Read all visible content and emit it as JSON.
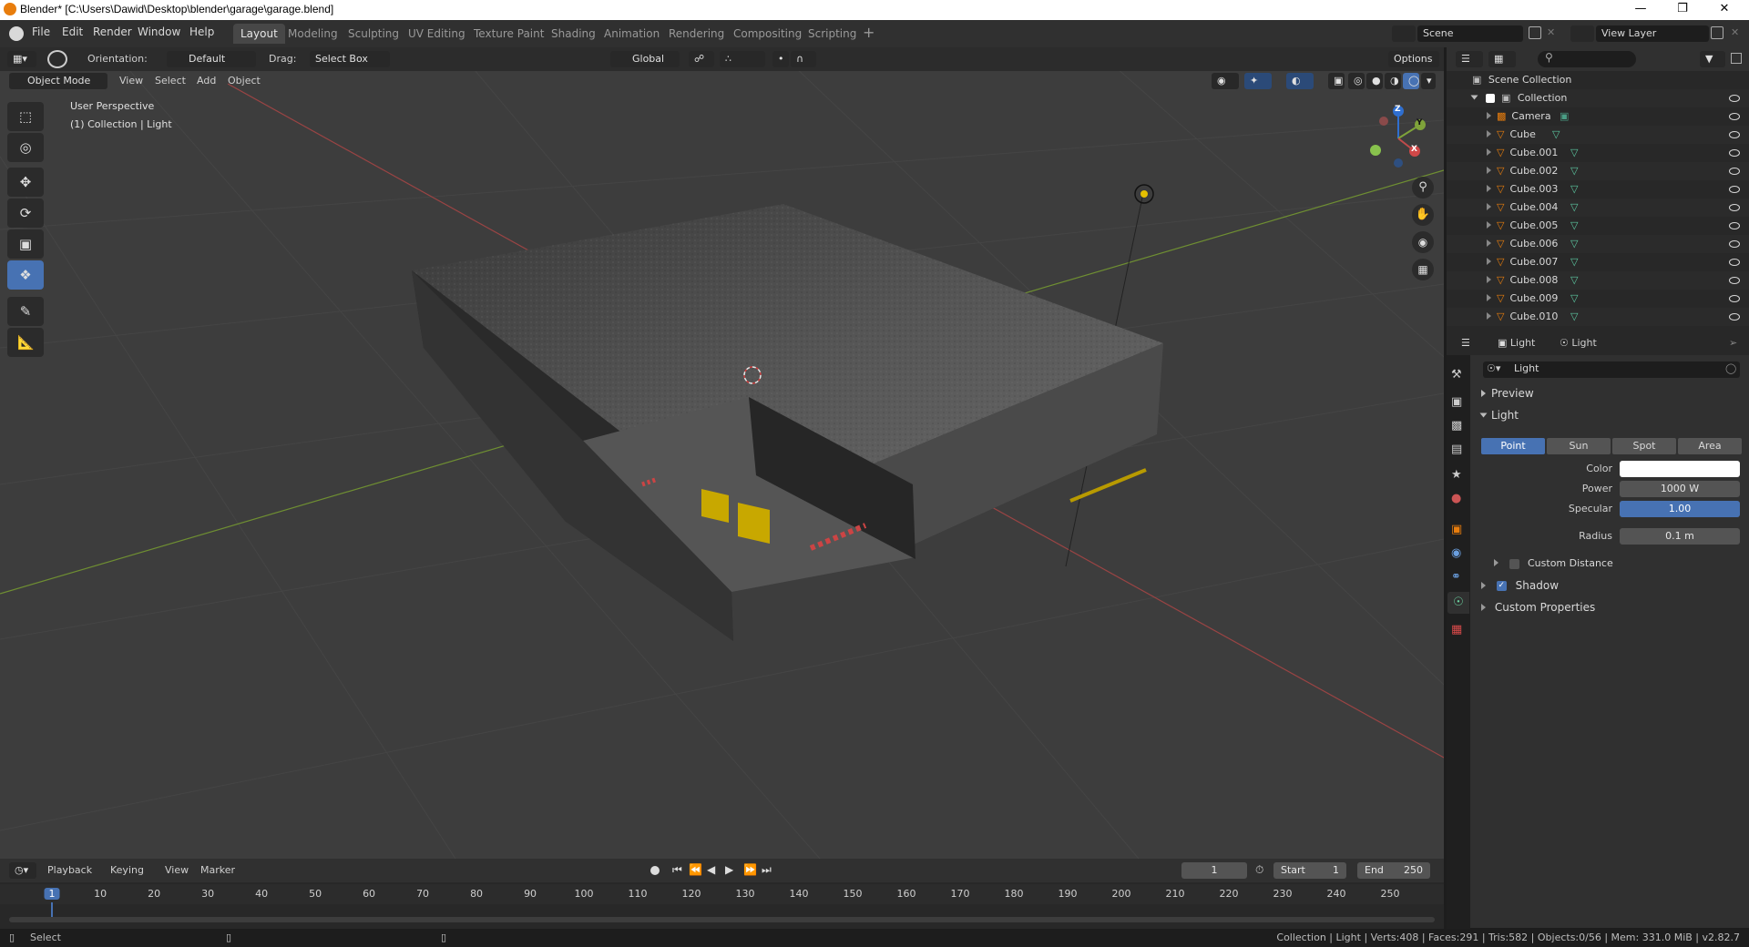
{
  "window": {
    "title": "Blender* [C:\\Users\\Dawid\\Desktop\\blender\\garage\\garage.blend]",
    "min_icon": "minimize-icon",
    "max_icon": "maximize-icon",
    "close_icon": "close-icon"
  },
  "menu": [
    "File",
    "Edit",
    "Render",
    "Window",
    "Help"
  ],
  "workspaces": [
    "Layout",
    "Modeling",
    "Sculpting",
    "UV Editing",
    "Texture Paint",
    "Shading",
    "Animation",
    "Rendering",
    "Compositing",
    "Scripting"
  ],
  "add_workspace": "+",
  "scene": {
    "name": "Scene",
    "view_layer": "View Layer"
  },
  "viewport_header": {
    "orientation_label": "Orientation:",
    "orientation_value": "Default",
    "drag_label": "Drag:",
    "drag_value": "Select Box",
    "transform": "Global",
    "options": "Options",
    "mode": "Object Mode",
    "menus": [
      "View",
      "Select",
      "Add",
      "Object"
    ]
  },
  "viewport_info": {
    "line1": "User Perspective",
    "line2": "(1) Collection | Light"
  },
  "gizmo": {
    "x": "X",
    "y": "Y",
    "z": "Z"
  },
  "outliner": {
    "root": "Scene Collection",
    "collection": "Collection",
    "items": [
      "Camera",
      "Cube",
      "Cube.001",
      "Cube.002",
      "Cube.003",
      "Cube.004",
      "Cube.005",
      "Cube.006",
      "Cube.007",
      "Cube.008",
      "Cube.009",
      "Cube.010"
    ]
  },
  "properties": {
    "breadcrumb_object": "Light",
    "breadcrumb_data": "Light",
    "datablock": "Light",
    "preview": "Preview",
    "light_panel": "Light",
    "types": [
      "Point",
      "Sun",
      "Spot",
      "Area"
    ],
    "active_type": "Point",
    "color_label": "Color",
    "power_label": "Power",
    "power_value": "1000 W",
    "specular_label": "Specular",
    "specular_value": "1.00",
    "specular_fill": 1.0,
    "radius_label": "Radius",
    "radius_value": "0.1 m",
    "custom_distance": "Custom Distance",
    "shadow": "Shadow",
    "custom_properties": "Custom Properties"
  },
  "timeline": {
    "menus": [
      "Playback",
      "Keying",
      "View",
      "Marker"
    ],
    "current_frame": "1",
    "start_label": "Start",
    "start_value": "1",
    "end_label": "End",
    "end_value": "250",
    "ruler": [
      "1",
      "10",
      "20",
      "30",
      "40",
      "50",
      "60",
      "70",
      "80",
      "90",
      "100",
      "110",
      "120",
      "130",
      "140",
      "150",
      "160",
      "170",
      "180",
      "190",
      "200",
      "210",
      "220",
      "230",
      "240",
      "250"
    ]
  },
  "status": {
    "left": "Select",
    "right": "Collection | Light | Verts:408 | Faces:291 | Tris:582 | Objects:0/56 | Mem: 331.0 MiB | v2.82.7"
  },
  "colors": {
    "accent": "#4772b3",
    "bg_viewport": "#3d3d3d",
    "x_axis": "#c04b4b",
    "y_axis": "#7fa33a",
    "yellow": "#c8a800",
    "orange": "#e87d0d"
  }
}
